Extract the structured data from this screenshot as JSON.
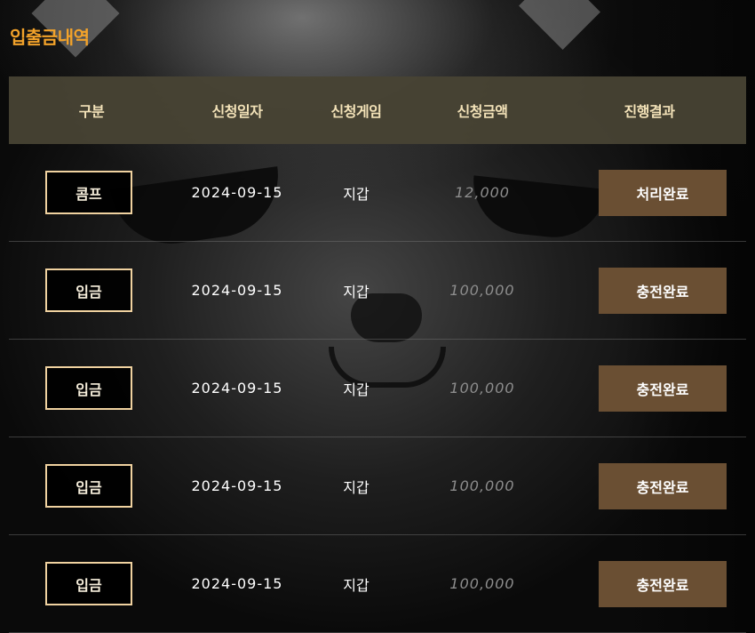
{
  "section_title": "입출금내역",
  "headers": {
    "type": "구분",
    "date": "신청일자",
    "game": "신청게임",
    "amount": "신청금액",
    "result": "진행결과"
  },
  "rows": [
    {
      "type": "콤프",
      "date": "2024-09-15",
      "game": "지갑",
      "amount": "12,000",
      "result": "처리완료"
    },
    {
      "type": "입금",
      "date": "2024-09-15",
      "game": "지갑",
      "amount": "100,000",
      "result": "충전완료"
    },
    {
      "type": "입금",
      "date": "2024-09-15",
      "game": "지갑",
      "amount": "100,000",
      "result": "충전완료"
    },
    {
      "type": "입금",
      "date": "2024-09-15",
      "game": "지갑",
      "amount": "100,000",
      "result": "충전완료"
    },
    {
      "type": "입금",
      "date": "2024-09-15",
      "game": "지갑",
      "amount": "100,000",
      "result": "충전완료"
    }
  ],
  "colors": {
    "title": "#f2a22a",
    "header_bg": "#484334",
    "header_text": "#f3e2b8",
    "status_bg": "#6a4f33",
    "type_border": "#f0d2a0",
    "amount_text": "#8d8d8d"
  }
}
